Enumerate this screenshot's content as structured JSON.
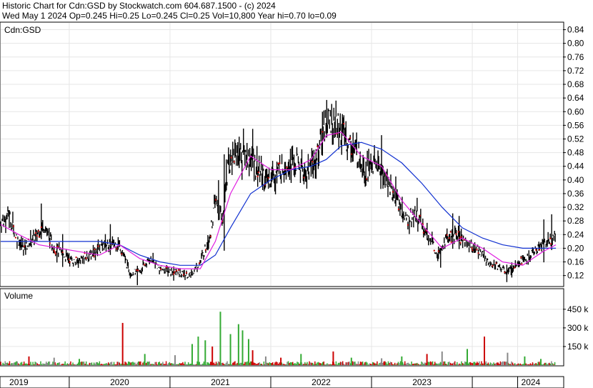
{
  "header": {
    "line1": "Historic Chart for Cdn:GSD by Stockwatch.com 604.687.1500 - (c) 2024",
    "line2": "Wed May  1 2024   Op=0.245  Hi=0.25  Lo=0.245  Cl=0.25  Vol=10,800  Year hi=0.70  lo=0.09"
  },
  "colors": {
    "price_bar": "#000000",
    "ma_short": "#e020e0",
    "ma_long": "#1030d0",
    "dots": "#cc0000",
    "vol_up": "#33aa33",
    "vol_down": "#cc0000",
    "vol_flat": "#888888"
  },
  "chart_data": [
    {
      "type": "ohlc",
      "panel_label": "Cdn:GSD",
      "ylim": [
        0.09,
        0.86
      ],
      "y_ticks": [
        0.12,
        0.16,
        0.2,
        0.24,
        0.28,
        0.32,
        0.36,
        0.4,
        0.44,
        0.48,
        0.52,
        0.56,
        0.6,
        0.64,
        0.68,
        0.72,
        0.76,
        0.8,
        0.84
      ],
      "y_tick_labels": [
        "0.12",
        "0.16",
        "0.20",
        "0.24",
        "0.28",
        "0.32",
        "0.36",
        "0.40",
        "0.44",
        "0.48",
        "0.52",
        "0.56",
        "0.60",
        "0.64",
        "0.68",
        "0.72",
        "0.76",
        "0.80",
        "0.84"
      ],
      "xlim": [
        2018.82,
        2024.4
      ],
      "close_path": {
        "x": [
          2018.82,
          2018.9,
          2018.98,
          2019.05,
          2019.15,
          2019.25,
          2019.35,
          2019.45,
          2019.55,
          2019.7,
          2019.85,
          2020.0,
          2020.1,
          2020.2,
          2020.3,
          2020.4,
          2020.55,
          2020.7,
          2020.8,
          2020.9,
          2020.95,
          2021.02,
          2021.08,
          2021.15,
          2021.25,
          2021.35,
          2021.45,
          2021.55,
          2021.65,
          2021.75,
          2021.85,
          2021.95,
          2022.05,
          2022.15,
          2022.25,
          2022.35,
          2022.45,
          2022.55,
          2022.65,
          2022.75,
          2022.85,
          2022.95,
          2023.05,
          2023.15,
          2023.25,
          2023.35,
          2023.45,
          2023.55,
          2023.65,
          2023.75,
          2023.85,
          2023.95,
          2024.05,
          2024.15,
          2024.25,
          2024.33
        ],
        "y": [
          0.27,
          0.3,
          0.23,
          0.2,
          0.23,
          0.27,
          0.2,
          0.18,
          0.16,
          0.18,
          0.21,
          0.21,
          0.13,
          0.13,
          0.17,
          0.14,
          0.13,
          0.12,
          0.16,
          0.24,
          0.34,
          0.28,
          0.45,
          0.48,
          0.48,
          0.44,
          0.4,
          0.42,
          0.45,
          0.45,
          0.42,
          0.46,
          0.58,
          0.56,
          0.52,
          0.48,
          0.43,
          0.45,
          0.4,
          0.34,
          0.28,
          0.3,
          0.24,
          0.19,
          0.23,
          0.24,
          0.21,
          0.2,
          0.16,
          0.15,
          0.13,
          0.16,
          0.17,
          0.2,
          0.22,
          0.24
        ]
      },
      "ma_short": {
        "x": [
          2018.82,
          2019.0,
          2019.2,
          2019.4,
          2019.6,
          2019.8,
          2020.0,
          2020.2,
          2020.4,
          2020.6,
          2020.8,
          2020.95,
          2021.1,
          2021.3,
          2021.5,
          2021.7,
          2021.9,
          2022.05,
          2022.2,
          2022.4,
          2022.6,
          2022.8,
          2023.0,
          2023.2,
          2023.4,
          2023.6,
          2023.8,
          2024.0,
          2024.2,
          2024.33
        ],
        "y": [
          0.27,
          0.24,
          0.21,
          0.2,
          0.19,
          0.18,
          0.21,
          0.17,
          0.15,
          0.14,
          0.14,
          0.22,
          0.36,
          0.47,
          0.43,
          0.43,
          0.46,
          0.53,
          0.54,
          0.47,
          0.44,
          0.34,
          0.27,
          0.2,
          0.23,
          0.2,
          0.16,
          0.15,
          0.19,
          0.21
        ]
      },
      "ma_long": {
        "x": [
          2018.82,
          2019.0,
          2019.2,
          2019.4,
          2019.6,
          2019.8,
          2020.0,
          2020.2,
          2020.4,
          2020.6,
          2020.8,
          2020.95,
          2021.1,
          2021.3,
          2021.5,
          2021.7,
          2021.9,
          2022.05,
          2022.2,
          2022.4,
          2022.6,
          2022.8,
          2023.0,
          2023.2,
          2023.4,
          2023.6,
          2023.8,
          2024.0,
          2024.2,
          2024.33
        ],
        "y": [
          0.22,
          0.22,
          0.22,
          0.22,
          0.22,
          0.22,
          0.21,
          0.18,
          0.16,
          0.15,
          0.15,
          0.18,
          0.26,
          0.36,
          0.4,
          0.43,
          0.44,
          0.46,
          0.5,
          0.51,
          0.49,
          0.45,
          0.39,
          0.32,
          0.26,
          0.23,
          0.21,
          0.2,
          0.2,
          0.2
        ]
      }
    },
    {
      "type": "bar",
      "panel_label": "Volume",
      "ylim": [
        0,
        610
      ],
      "y_ticks": [
        150,
        300,
        450
      ],
      "y_tick_labels": [
        "150 k",
        "300 k",
        "450 k"
      ],
      "spikes": {
        "x": [
          2019.1,
          2019.35,
          2019.6,
          2020.03,
          2020.25,
          2020.55,
          2020.72,
          2020.78,
          2020.85,
          2020.92,
          2021.0,
          2021.1,
          2021.18,
          2021.22,
          2021.28,
          2021.32,
          2021.45,
          2021.6,
          2021.8,
          2022.12,
          2022.3,
          2022.6,
          2022.8,
          2023.05,
          2023.2,
          2023.45,
          2023.62,
          2023.85,
          2024.02,
          2024.18
        ],
        "values": [
          70,
          60,
          50,
          340,
          90,
          80,
          170,
          230,
          200,
          150,
          430,
          250,
          330,
          280,
          210,
          120,
          70,
          60,
          90,
          110,
          60,
          55,
          70,
          90,
          110,
          130,
          230,
          100,
          70,
          50
        ],
        "color": [
          "down",
          "flat",
          "up",
          "down",
          "up",
          "flat",
          "up",
          "up",
          "up",
          "down",
          "up",
          "up",
          "up",
          "up",
          "up",
          "down",
          "flat",
          "down",
          "up",
          "down",
          "up",
          "flat",
          "up",
          "down",
          "flat",
          "up",
          "down",
          "flat",
          "up",
          "up"
        ]
      }
    }
  ],
  "x_axis": {
    "labels": [
      "2019",
      "2020",
      "2021",
      "2022",
      "2023",
      "2024"
    ],
    "label_x": [
      2019.0,
      2020.0,
      2021.0,
      2022.0,
      2023.0,
      2024.08
    ],
    "separators": [
      2019.5,
      2020.5,
      2021.5,
      2022.5,
      2023.5,
      2023.95
    ]
  }
}
